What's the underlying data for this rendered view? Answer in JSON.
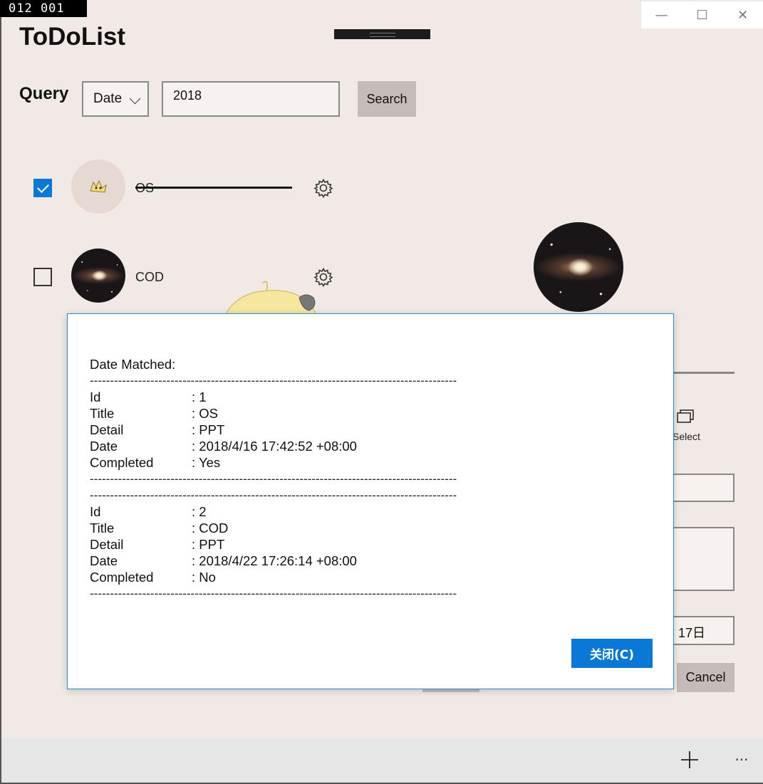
{
  "fps_counter": "012   001",
  "app_title": "ToDoList",
  "caption": {
    "minimize": "—",
    "maximize": "☐",
    "close": "✕"
  },
  "query": {
    "label": "Query",
    "field_selected": "Date",
    "search_value": "2018",
    "search_button": "Search"
  },
  "todo_items": [
    {
      "title": "OS",
      "completed": true
    },
    {
      "title": "COD",
      "completed": false
    }
  ],
  "right_panel": {
    "select_label": "Select",
    "date_value": "17日",
    "cancel_label": "Cancel"
  },
  "dialog": {
    "heading": "Date Matched:",
    "separator": "-------------------------------------------------------------------------------------------",
    "records": [
      {
        "fields": [
          {
            "key": "Id",
            "value": ": 1"
          },
          {
            "key": "Title",
            "value": ": OS"
          },
          {
            "key": "Detail",
            "value": ": PPT"
          },
          {
            "key": "Date",
            "value": ": 2018/4/16 17:42:52 +08:00"
          },
          {
            "key": "Completed",
            "value": ": Yes"
          }
        ]
      },
      {
        "fields": [
          {
            "key": "Id",
            "value": ": 2"
          },
          {
            "key": "Title",
            "value": ": COD"
          },
          {
            "key": "Detail",
            "value": ": PPT"
          },
          {
            "key": "Date",
            "value": ": 2018/4/22 17:26:14 +08:00"
          },
          {
            "key": "Completed",
            "value": ": No"
          }
        ]
      }
    ],
    "close_button": "关闭(C)"
  },
  "command_bar": {
    "more": "···"
  },
  "colors": {
    "accent": "#0a78d4",
    "background": "#f1e9e5",
    "button_gray": "#c5bbb8"
  }
}
